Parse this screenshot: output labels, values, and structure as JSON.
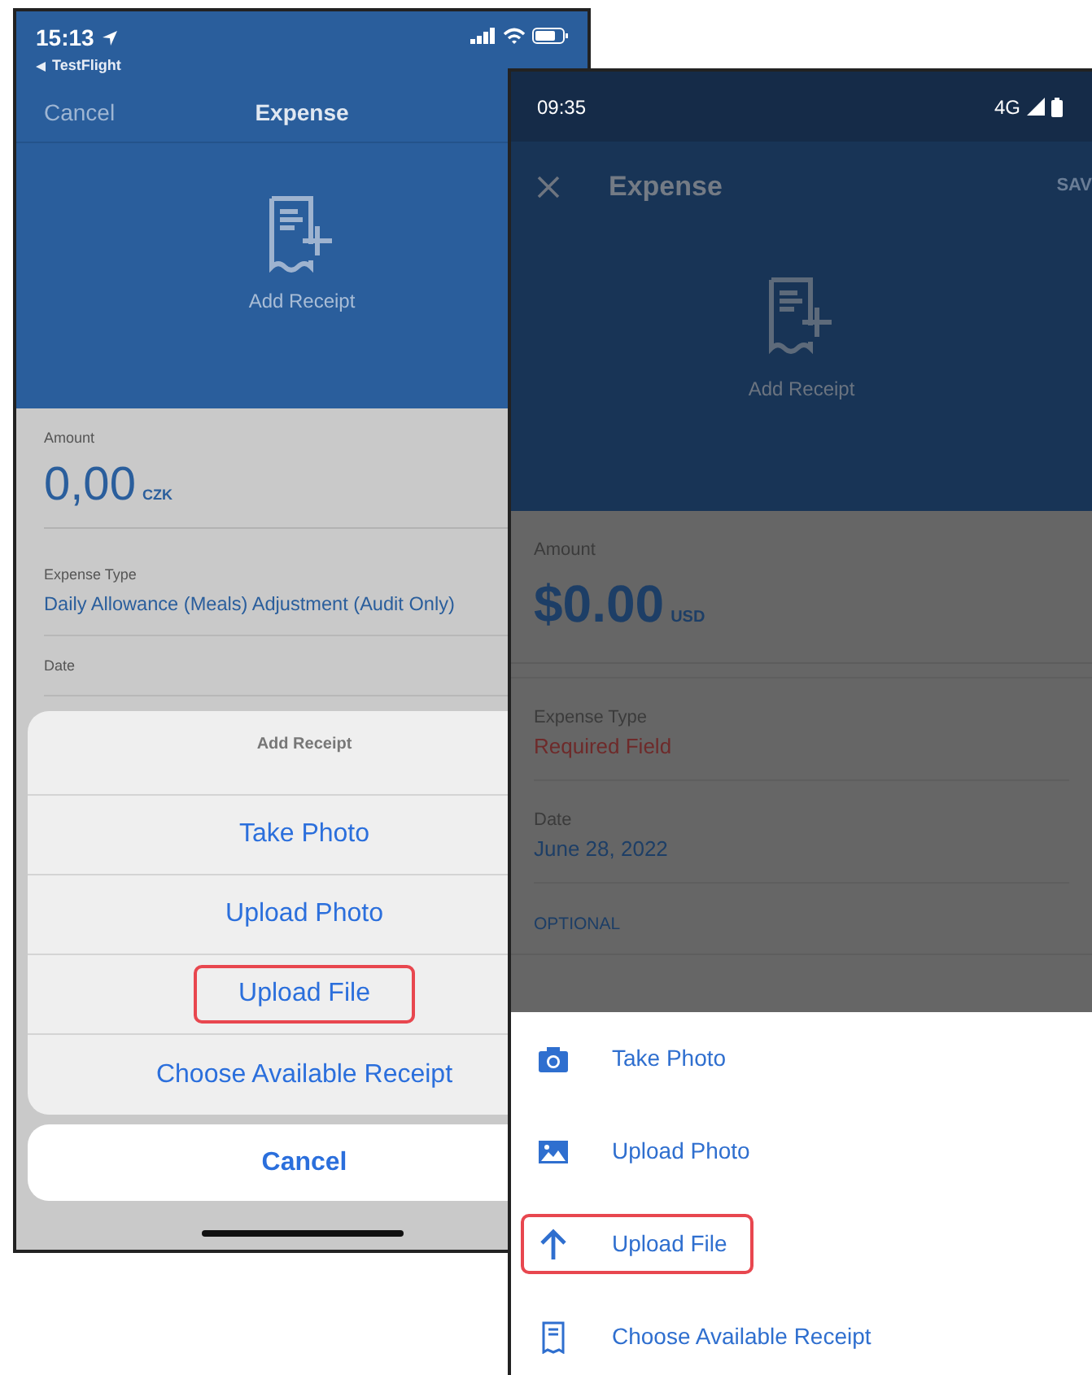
{
  "ios_screen": {
    "status_bar": {
      "time": "15:13",
      "back_app": "TestFlight"
    },
    "nav_bar": {
      "cancel": "Cancel",
      "title": "Expense"
    },
    "header": {
      "label": "Add Receipt"
    },
    "amount": {
      "label": "Amount",
      "value": "0,00",
      "currency": "CZK"
    },
    "fields": [
      {
        "label": "Expense Type",
        "value": "Daily Allowance (Meals) Adjustment (Audit Only)"
      },
      {
        "label": "Date"
      }
    ],
    "action_sheet": {
      "title": "Add Receipt",
      "options": [
        {
          "label": "Take Photo",
          "highlighted": false
        },
        {
          "label": "Upload Photo",
          "highlighted": false
        },
        {
          "label": "Upload File",
          "highlighted": true
        },
        {
          "label": "Choose Available Receipt",
          "highlighted": false
        }
      ],
      "cancel": "Cancel"
    }
  },
  "android_screen": {
    "status_bar": {
      "time": "09:35",
      "network": "4G"
    },
    "toolbar": {
      "title": "Expense",
      "action": "SAV"
    },
    "header": {
      "label": "Add Receipt"
    },
    "amount": {
      "label": "Amount",
      "value": "$0.00",
      "currency": "USD"
    },
    "fields": [
      {
        "label": "Expense Type",
        "value": "Required Field",
        "kind": "error"
      },
      {
        "label": "Date",
        "value": "June 28, 2022",
        "kind": "normal"
      }
    ],
    "section": "OPTIONAL",
    "bottom_sheet": {
      "options": [
        {
          "kind": "camera",
          "label": "Take Photo",
          "highlighted": false
        },
        {
          "kind": "image",
          "label": "Upload Photo",
          "highlighted": false
        },
        {
          "kind": "upload",
          "label": "Upload File",
          "highlighted": true
        },
        {
          "kind": "receipt",
          "label": "Choose Available Receipt",
          "highlighted": false
        }
      ]
    }
  }
}
